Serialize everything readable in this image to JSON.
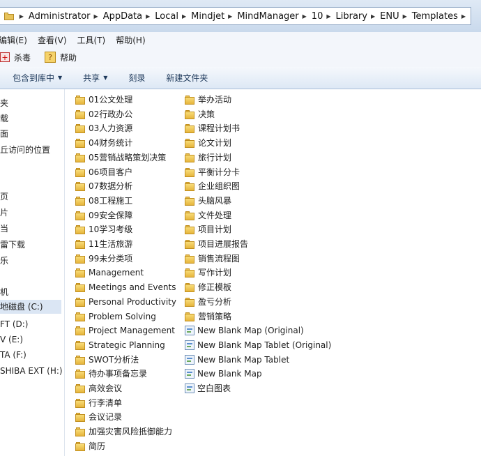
{
  "address": {
    "crumbs": [
      "Administrator",
      "AppData",
      "Local",
      "Mindjet",
      "MindManager",
      "10",
      "Library",
      "ENU",
      "Templates"
    ]
  },
  "menu": [
    "编辑(E)",
    "查看(V)",
    "工具(T)",
    "帮助(H)"
  ],
  "toolbar": {
    "antivirus": "杀毒",
    "help": "帮助"
  },
  "commands": {
    "include_library": "包含到库中",
    "share": "共享",
    "burn": "刻录",
    "new_folder": "新建文件夹"
  },
  "nav": {
    "items": [
      "夹",
      "载",
      "面",
      "丘访问的位置",
      "页",
      "片",
      "当",
      "雷下载",
      "乐",
      "机",
      "地磁盘 (C:)",
      "FT (D:)",
      "V (E:)",
      "TA (F:)",
      "SHIBA EXT (H:)"
    ],
    "selected": "地磁盘 (C:)"
  },
  "files": {
    "column1": [
      {
        "name": "01公文处理",
        "type": "folder"
      },
      {
        "name": "02行政办公",
        "type": "folder"
      },
      {
        "name": "03人力资源",
        "type": "folder"
      },
      {
        "name": "04财务统计",
        "type": "folder"
      },
      {
        "name": "05营销战略策划决策",
        "type": "folder"
      },
      {
        "name": "06项目客户",
        "type": "folder"
      },
      {
        "name": "07数据分析",
        "type": "folder"
      },
      {
        "name": "08工程施工",
        "type": "folder"
      },
      {
        "name": "09安全保障",
        "type": "folder"
      },
      {
        "name": "10学习考级",
        "type": "folder"
      },
      {
        "name": "11生活旅游",
        "type": "folder"
      },
      {
        "name": "99未分类项",
        "type": "folder"
      },
      {
        "name": "Management",
        "type": "folder"
      },
      {
        "name": "Meetings and Events",
        "type": "folder"
      },
      {
        "name": "Personal Productivity",
        "type": "folder"
      },
      {
        "name": "Problem Solving",
        "type": "folder"
      },
      {
        "name": "Project Management",
        "type": "folder"
      },
      {
        "name": "Strategic Planning",
        "type": "folder"
      },
      {
        "name": "SWOT分析法",
        "type": "folder"
      },
      {
        "name": "待办事项备忘录",
        "type": "folder"
      },
      {
        "name": "高效会议",
        "type": "folder"
      },
      {
        "name": "行李清单",
        "type": "folder"
      },
      {
        "name": "会议记录",
        "type": "folder"
      },
      {
        "name": "加强灾害风险抵御能力",
        "type": "folder"
      },
      {
        "name": "简历",
        "type": "folder"
      }
    ],
    "column2": [
      {
        "name": "举办活动",
        "type": "folder"
      },
      {
        "name": "决策",
        "type": "folder"
      },
      {
        "name": "课程计划书",
        "type": "folder"
      },
      {
        "name": "论文计划",
        "type": "folder"
      },
      {
        "name": "旅行计划",
        "type": "folder"
      },
      {
        "name": "平衡计分卡",
        "type": "folder"
      },
      {
        "name": "企业组织图",
        "type": "folder"
      },
      {
        "name": "头脑风暴",
        "type": "folder"
      },
      {
        "name": "文件处理",
        "type": "folder"
      },
      {
        "name": "项目计划",
        "type": "folder"
      },
      {
        "name": "项目进展报告",
        "type": "folder"
      },
      {
        "name": "销售流程图",
        "type": "folder"
      },
      {
        "name": "写作计划",
        "type": "folder"
      },
      {
        "name": "修正模板",
        "type": "folder"
      },
      {
        "name": "盈亏分析",
        "type": "folder"
      },
      {
        "name": "营销策略",
        "type": "folder"
      },
      {
        "name": "New Blank Map (Original)",
        "type": "map"
      },
      {
        "name": "New Blank Map Tablet (Original)",
        "type": "map"
      },
      {
        "name": "New Blank Map Tablet",
        "type": "map"
      },
      {
        "name": "New Blank Map",
        "type": "map"
      },
      {
        "name": "空白图表",
        "type": "map"
      }
    ]
  }
}
